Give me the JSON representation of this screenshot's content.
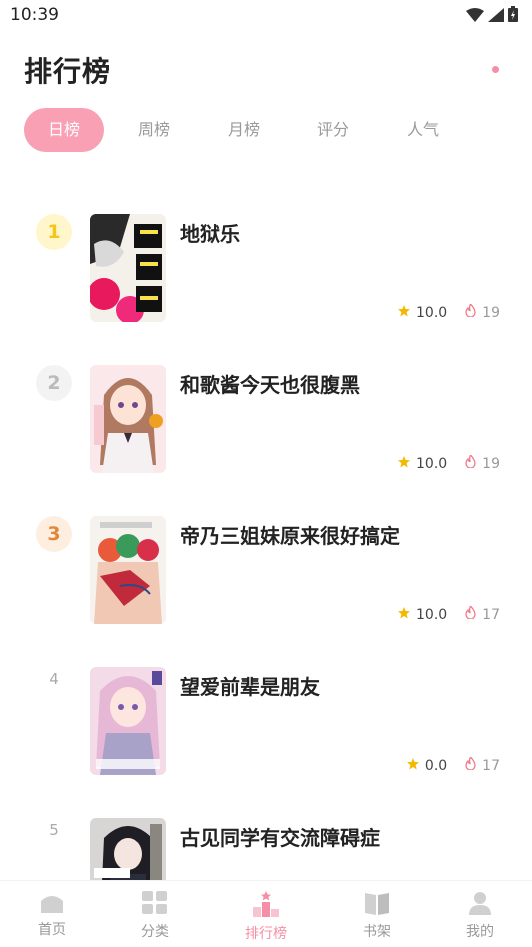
{
  "status_bar": {
    "time": "10:39"
  },
  "header": {
    "title": "排行榜"
  },
  "tabs": [
    {
      "label": "日榜",
      "active": true
    },
    {
      "label": "周榜",
      "active": false
    },
    {
      "label": "月榜",
      "active": false
    },
    {
      "label": "评分",
      "active": false
    },
    {
      "label": "人气",
      "active": false
    }
  ],
  "rankings": [
    {
      "rank": "1",
      "title": "地狱乐",
      "rating": "10.0",
      "heat": "19",
      "cover_icon": "cover-jigokuraku"
    },
    {
      "rank": "2",
      "title": "和歌酱今天也很腹黑",
      "rating": "10.0",
      "heat": "19",
      "cover_icon": "cover-wakachan"
    },
    {
      "rank": "3",
      "title": "帝乃三姐妹原来很好搞定",
      "rating": "10.0",
      "heat": "17",
      "cover_icon": "cover-teino-sisters"
    },
    {
      "rank": "4",
      "title": "望爱前辈是朋友",
      "rating": "0.0",
      "heat": "17",
      "cover_icon": "cover-nozomi-senpai"
    },
    {
      "rank": "5",
      "title": "古见同学有交流障碍症",
      "rating": "",
      "heat": "",
      "cover_icon": "cover-komi-san"
    }
  ],
  "bottom_nav": [
    {
      "label": "首页",
      "icon": "home-icon",
      "active": false
    },
    {
      "label": "分类",
      "icon": "grid-icon",
      "active": false
    },
    {
      "label": "排行榜",
      "icon": "ranking-icon",
      "active": true
    },
    {
      "label": "书架",
      "icon": "bookshelf-icon",
      "active": false
    },
    {
      "label": "我的",
      "icon": "user-icon",
      "active": false
    }
  ],
  "colors": {
    "accent": "#f9a0b5",
    "rank1": "#f5c518",
    "rank2": "#bbbbbb",
    "rank3": "#e0883a",
    "star": "#f5b800",
    "fire": "#f07a8a"
  }
}
